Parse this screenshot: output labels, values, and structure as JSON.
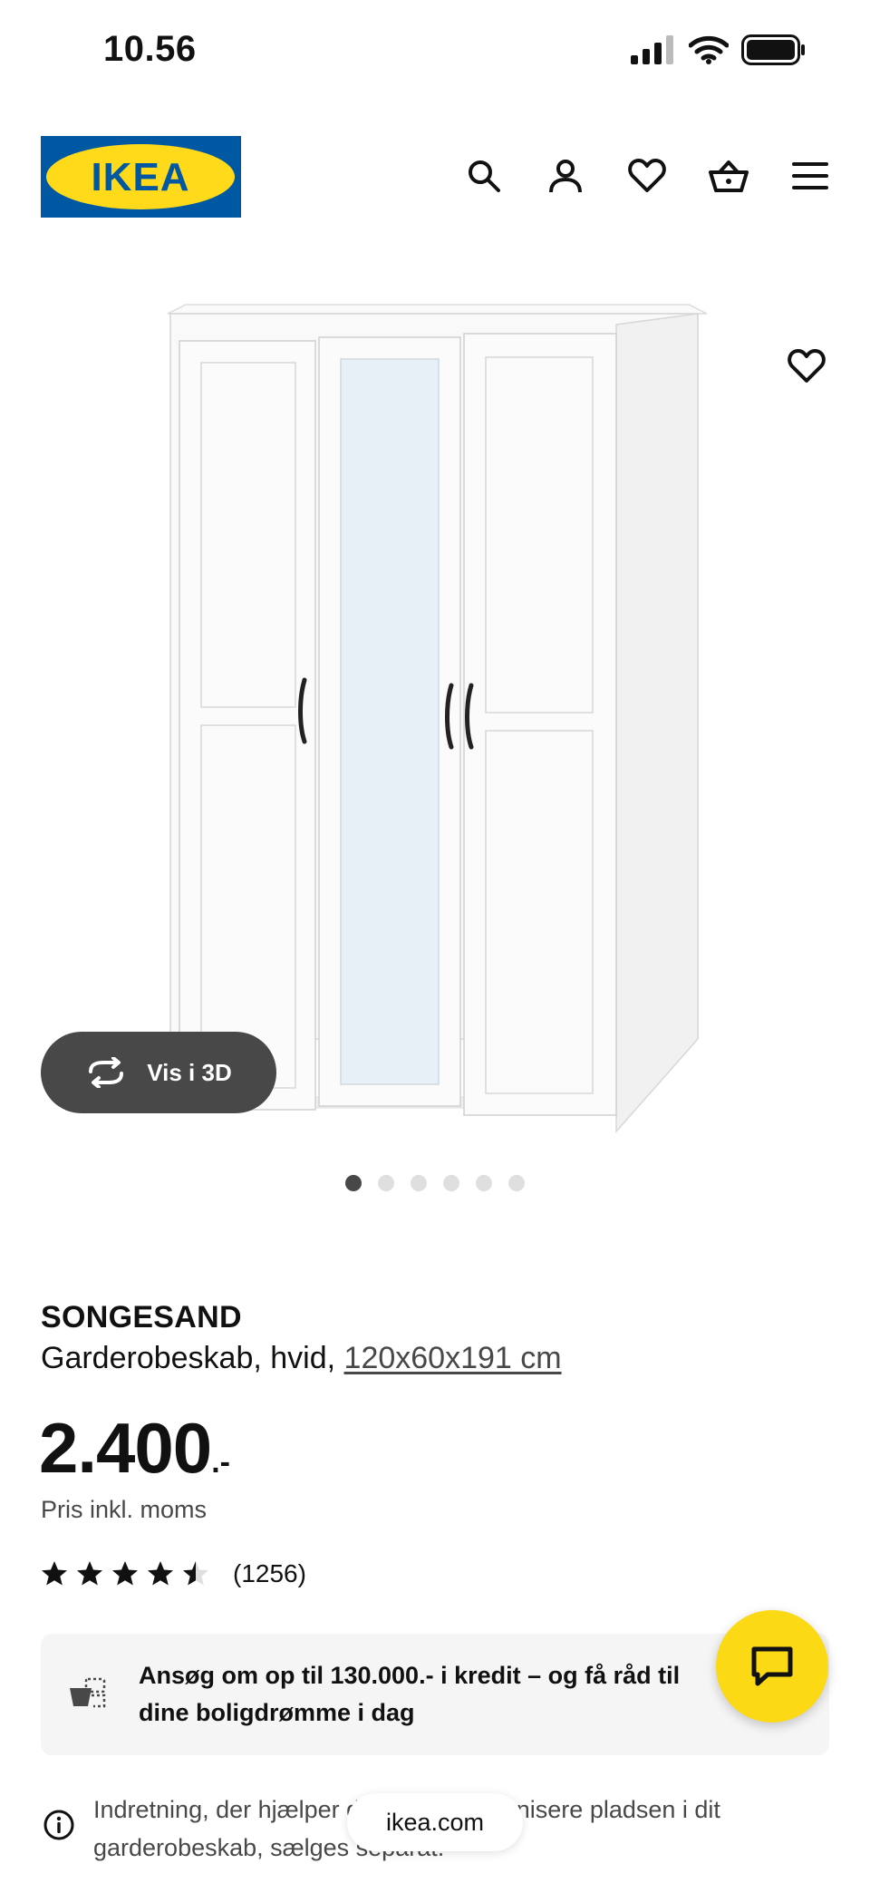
{
  "status_bar": {
    "time": "10.56"
  },
  "header": {
    "logo_text": "IKEA",
    "icons": [
      "search-icon",
      "account-icon",
      "heart-icon",
      "basket-icon",
      "menu-icon"
    ]
  },
  "product_image": {
    "vis3d_label": "Vis i 3D",
    "gallery_count": 6,
    "gallery_active_index": 0
  },
  "product": {
    "name": "SONGESAND",
    "description": "Garderobeskab, hvid,",
    "dimensions": "120x60x191 cm",
    "price": "2.400",
    "price_suffix": ".-",
    "price_note": "Pris inkl. moms",
    "rating": 4.5,
    "rating_max": 5,
    "review_count": "(1256)"
  },
  "credit_banner": {
    "text": "Ansøg om op til 130.000.- i kredit – og få råd til dine boligdrømme i dag"
  },
  "info_row": {
    "text": "Indretning, der hjælper dig med at organisere pladsen i dit garderobeskab, sælges separat."
  },
  "browser": {
    "url": "ikea.com"
  },
  "colors": {
    "ikea_blue": "#0058a3",
    "ikea_yellow": "#ffda1a",
    "chat_yellow": "#fbd914",
    "dark_button": "#484848"
  }
}
